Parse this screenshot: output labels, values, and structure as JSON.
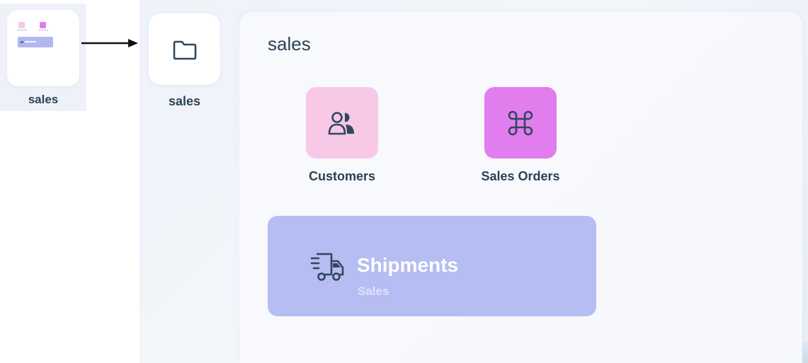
{
  "mini_widget": {
    "label": "sales"
  },
  "folder": {
    "label": "sales",
    "icon": "folder-icon"
  },
  "panel": {
    "title": "sales",
    "apps": [
      {
        "label": "Customers",
        "icon": "users-icon",
        "color": "#f7c9e7"
      },
      {
        "label": "Sales Orders",
        "icon": "command-icon",
        "color": "#e27ded"
      }
    ],
    "widget": {
      "title": "Shipments",
      "subtitle": "Sales",
      "icon": "truck-icon",
      "color": "#b5bdf2"
    }
  }
}
